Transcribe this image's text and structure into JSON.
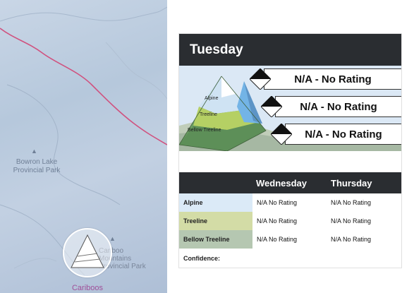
{
  "map": {
    "park_name": "Bowron Lake Provincial Park",
    "park2_name": "Cariboo Mountains Provincial Park",
    "region_label": "Cariboos"
  },
  "forecast": {
    "day": "Tuesday",
    "ratings": [
      {
        "elevation": "Alpine",
        "text": "N/A - No Rating"
      },
      {
        "elevation": "Treeline",
        "text": "N/A - No Rating"
      },
      {
        "elevation": "Bellow Treeline",
        "text": "N/A - No Rating"
      }
    ],
    "graphic_labels": {
      "alpine": "Alpine",
      "treeline": "Treeline",
      "below": "Bellow Treeline"
    }
  },
  "outlook": {
    "columns": [
      "Wednesday",
      "Thursday"
    ],
    "rows": [
      {
        "label": "Alpine",
        "color": "#dbeaf7",
        "values": [
          "N/A No Rating",
          "N/A No Rating"
        ]
      },
      {
        "label": "Treeline",
        "color": "#d3dca6",
        "values": [
          "N/A No Rating",
          "N/A No Rating"
        ]
      },
      {
        "label": "Bellow Treeline",
        "color": "#b5c7b1",
        "values": [
          "N/A No Rating",
          "N/A No Rating"
        ]
      }
    ],
    "confidence_label": "Confidence:"
  }
}
